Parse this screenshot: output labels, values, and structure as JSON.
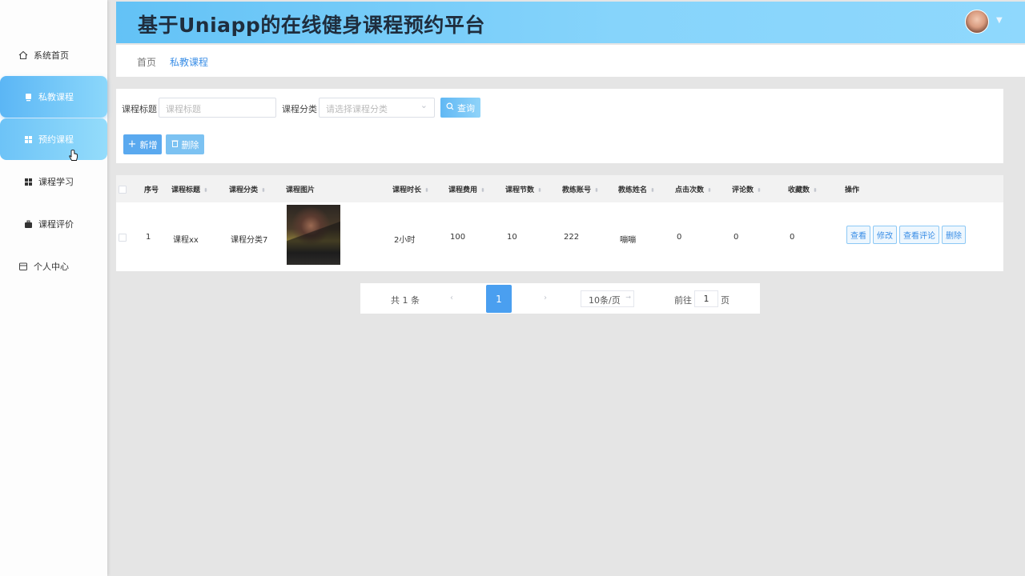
{
  "app": {
    "title": "基于Uniapp的在线健身课程预约平台"
  },
  "sidebar": {
    "items": [
      {
        "label": "系统首页",
        "icon": "home-icon"
      },
      {
        "label": "私教课程",
        "icon": "tablet-icon"
      },
      {
        "label": "预约课程",
        "icon": "grid-icon"
      },
      {
        "label": "课程学习",
        "icon": "grid-icon"
      },
      {
        "label": "课程评价",
        "icon": "briefcase-icon"
      },
      {
        "label": "个人中心",
        "icon": "calendar-icon"
      }
    ]
  },
  "breadcrumb": {
    "home": "首页",
    "current": "私教课程"
  },
  "search": {
    "title_label": "课程标题",
    "title_placeholder": "课程标题",
    "category_label": "课程分类",
    "category_placeholder": "请选择课程分类",
    "query_button": "查询",
    "add_button": "新增",
    "delete_button": "删除"
  },
  "table": {
    "headers": [
      "序号",
      "课程标题",
      "课程分类",
      "课程图片",
      "课程时长",
      "课程费用",
      "课程节数",
      "教练账号",
      "教练姓名",
      "点击次数",
      "评论数",
      "收藏数",
      "操作"
    ],
    "rows": [
      {
        "index": "1",
        "title": "课程xx",
        "category": "课程分类7",
        "duration": "2小时",
        "fee": "100",
        "sessions": "10",
        "coach_account": "222",
        "coach_name": "嘣嘣",
        "clicks": "0",
        "comments": "0",
        "favorites": "0",
        "actions": [
          "查看",
          "修改",
          "查看评论",
          "删除"
        ]
      }
    ]
  },
  "pagination": {
    "total": "共 1 条",
    "current_page": "1",
    "page_size": "10条/页",
    "goto_label": "前往",
    "goto_value": "1",
    "page_suffix": "页"
  },
  "colors": {
    "accent": "#4a9ff0",
    "header_gradient_start": "#63c2f6",
    "header_gradient_end": "#8fd8fd"
  }
}
